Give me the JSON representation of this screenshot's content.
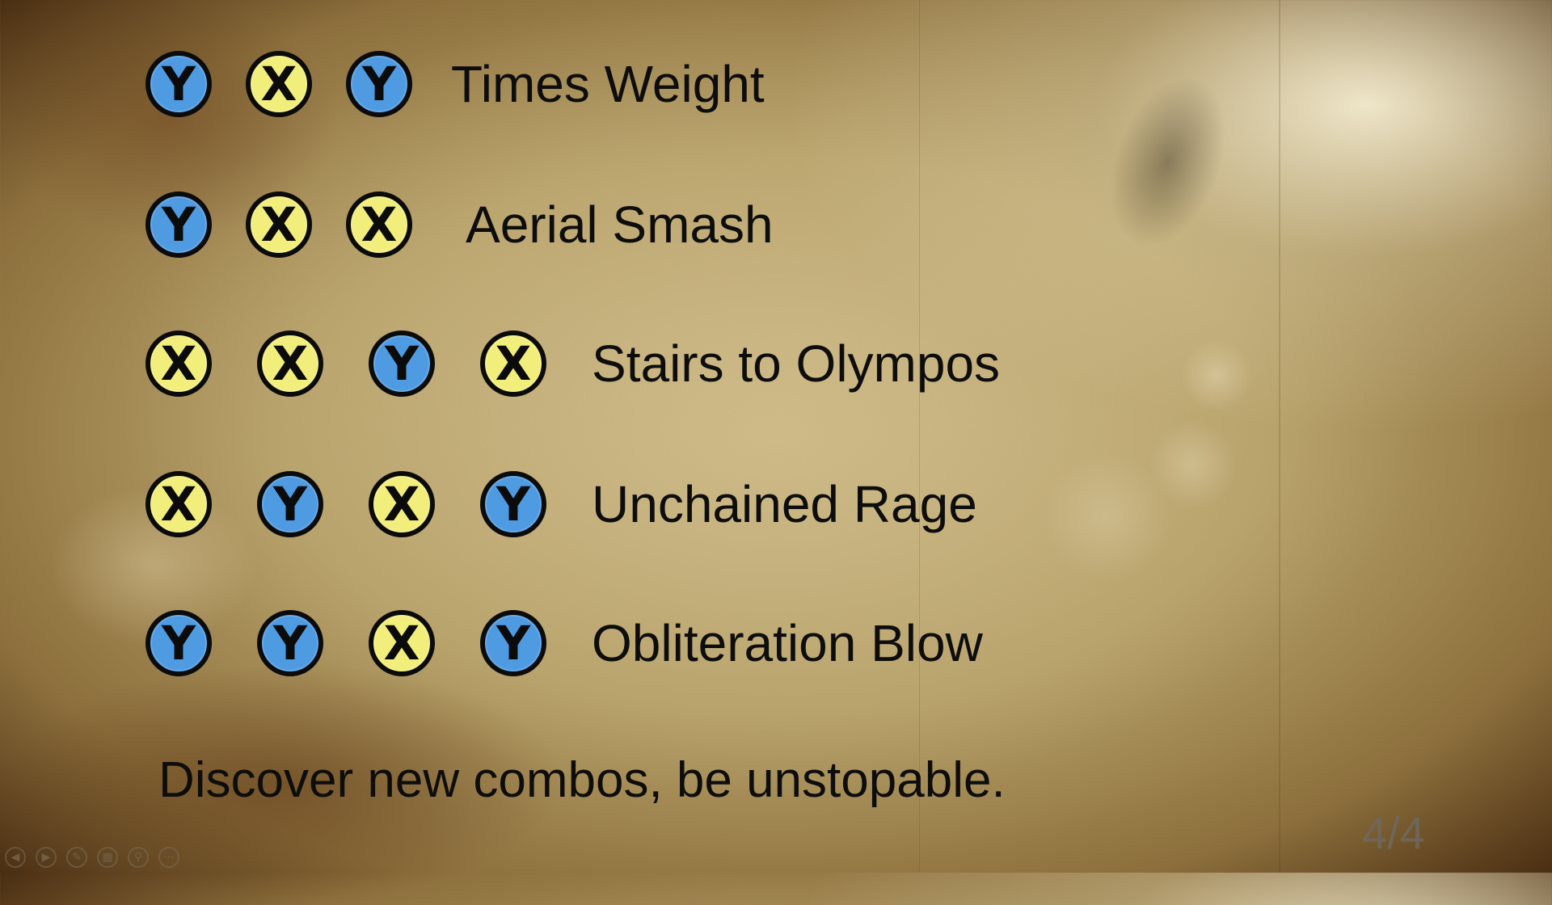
{
  "combos": [
    {
      "buttons": [
        "Y",
        "X",
        "Y"
      ],
      "name": "Times Weight"
    },
    {
      "buttons": [
        "Y",
        "X",
        "X"
      ],
      "name": "Aerial Smash"
    },
    {
      "buttons": [
        "X",
        "X",
        "Y",
        "X"
      ],
      "name": "Stairs to Olympos"
    },
    {
      "buttons": [
        "X",
        "Y",
        "X",
        "Y"
      ],
      "name": "Unchained Rage"
    },
    {
      "buttons": [
        "Y",
        "Y",
        "X",
        "Y"
      ],
      "name": "Obliteration Blow"
    }
  ],
  "tagline": "Discover new combos, be unstopable.",
  "page_indicator": "4/4",
  "colors": {
    "y_button": "#4f9be2",
    "x_button": "#f2ee7c"
  },
  "nav_controls": [
    {
      "icon": "previous-icon",
      "glyph": "◀"
    },
    {
      "icon": "next-icon",
      "glyph": "▶"
    },
    {
      "icon": "pen-icon",
      "glyph": "✎"
    },
    {
      "icon": "slides-icon",
      "glyph": "▦"
    },
    {
      "icon": "zoom-icon",
      "glyph": "⚲"
    },
    {
      "icon": "more-icon",
      "glyph": "⋯"
    }
  ]
}
